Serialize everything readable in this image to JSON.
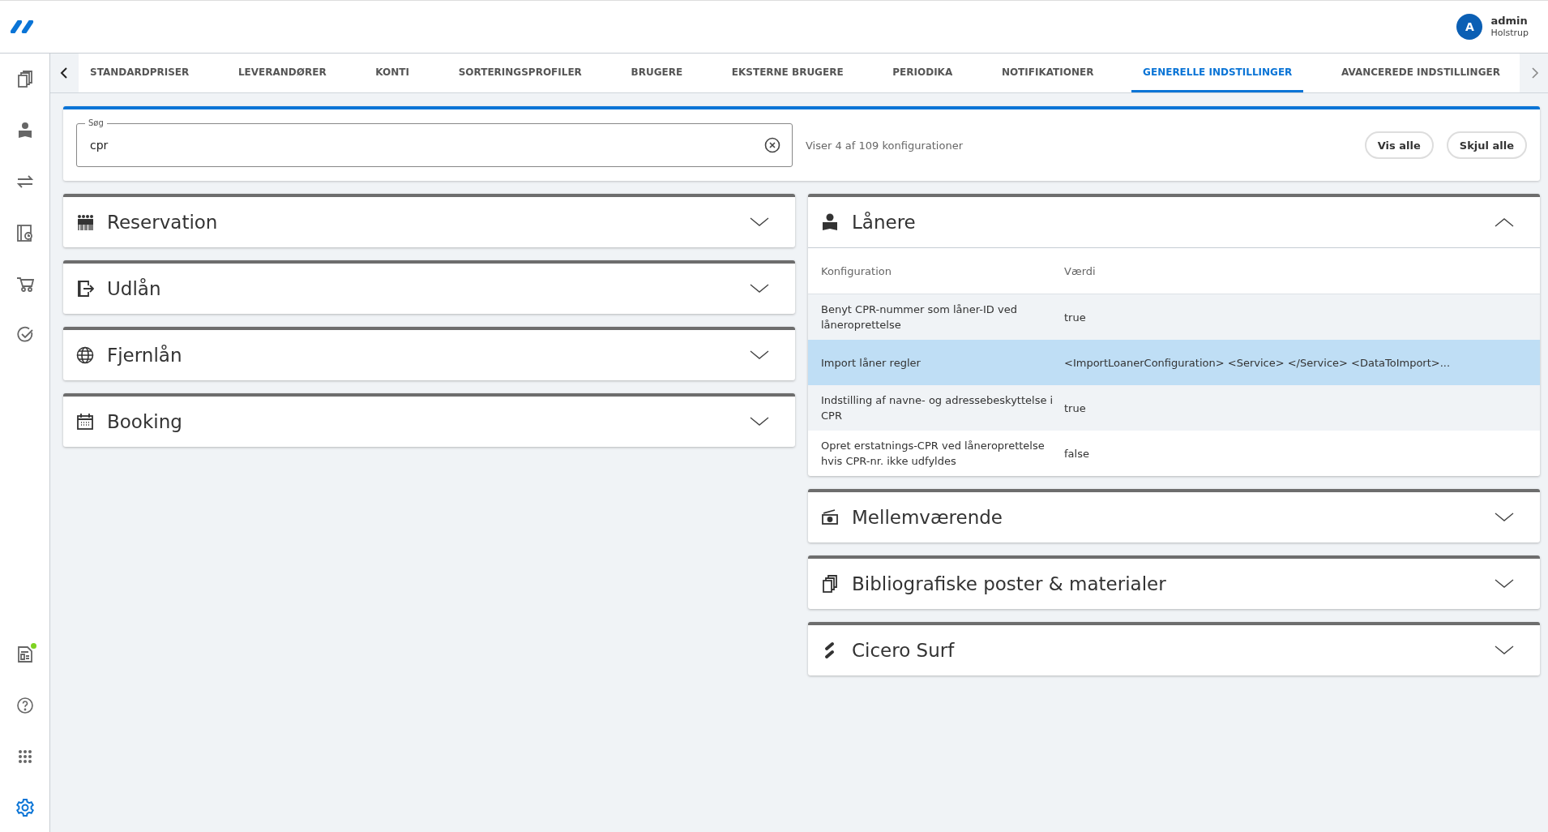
{
  "user": {
    "initial": "A",
    "name": "admin",
    "location": "Holstrup"
  },
  "sidebar": {
    "items": [
      {
        "selected": false
      },
      {
        "selected": false
      },
      {
        "selected": false
      },
      {
        "selected": false
      },
      {
        "selected": false
      },
      {
        "selected": false
      }
    ],
    "bottom_items": [
      {
        "selected": false,
        "notification": true
      },
      {
        "selected": false,
        "notification": false
      },
      {
        "selected": false,
        "notification": false
      },
      {
        "selected": true,
        "notification": false
      }
    ]
  },
  "tabs": [
    {
      "label": "STANDARDPRISER",
      "selected": false
    },
    {
      "label": "LEVERANDØRER",
      "selected": false
    },
    {
      "label": "KONTI",
      "selected": false
    },
    {
      "label": "SORTERINGSPROFILER",
      "selected": false
    },
    {
      "label": "BRUGERE",
      "selected": false
    },
    {
      "label": "EKSTERNE BRUGERE",
      "selected": false
    },
    {
      "label": "PERIODIKA",
      "selected": false
    },
    {
      "label": "NOTIFIKATIONER",
      "selected": false
    },
    {
      "label": "GENERELLE INDSTILLINGER",
      "selected": true
    },
    {
      "label": "AVANCEREDE INDSTILLINGER",
      "selected": false
    }
  ],
  "search": {
    "label": "Søg",
    "value": "cpr",
    "result_text": "Viser 4 af 109 konfigurationer",
    "buttons": [
      "Vis alle",
      "Skjul alle"
    ]
  },
  "left_sections": [
    {
      "title": "Reservation",
      "expanded": false
    },
    {
      "title": "Udlån",
      "expanded": false
    },
    {
      "title": "Fjernlån",
      "expanded": false
    },
    {
      "title": "Booking",
      "expanded": false
    }
  ],
  "right_sections": [
    {
      "title": "Lånere",
      "expanded": true,
      "columns": [
        "Konfiguration",
        "Værdi"
      ],
      "rows": [
        {
          "name": "Benyt CPR-nummer som låner-ID ved låneroprettelse",
          "value": "true",
          "selected": false
        },
        {
          "name": "Import låner regler",
          "value": "<ImportLoanerConfiguration> <Service> </Service> <DataToImport>...",
          "selected": true
        },
        {
          "name": "Indstilling af navne- og adressebeskyttelse i CPR",
          "value": "true",
          "selected": false
        },
        {
          "name": "Opret erstatnings-CPR ved låneroprettelse hvis CPR-nr. ikke udfyldes",
          "value": "false",
          "selected": false
        }
      ]
    },
    {
      "title": "Mellemværende",
      "expanded": false
    },
    {
      "title": "Bibliografiske poster & materialer",
      "expanded": false
    },
    {
      "title": "Cicero Surf",
      "expanded": false
    }
  ]
}
